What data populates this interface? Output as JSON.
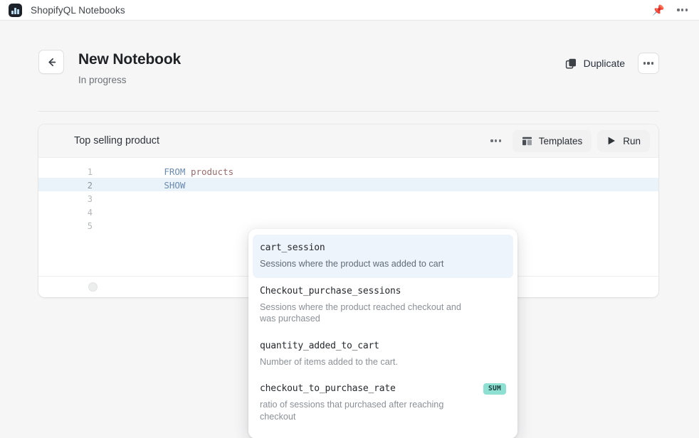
{
  "topbar": {
    "app_icon": "bar-chart-icon",
    "title": "ShopifyQL Notebooks",
    "pin_icon": "pin-icon",
    "menu_icon": "kebab-menu-icon"
  },
  "header": {
    "back_icon": "arrow-left-icon",
    "title": "New Notebook",
    "status": "In progress",
    "duplicate_label": "Duplicate",
    "duplicate_icon": "duplicate-icon",
    "more_icon": "kebab-menu-icon"
  },
  "cell": {
    "title": "Top selling product",
    "kebab_icon": "kebab-menu-icon",
    "templates_label": "Templates",
    "templates_icon": "templates-layout-icon",
    "run_label": "Run",
    "run_icon": "play-icon",
    "footer_icon": "add-cell-icon",
    "code": [
      {
        "number": "1",
        "active": false,
        "keyword": "FROM",
        "identifier": " products"
      },
      {
        "number": "2",
        "active": true,
        "keyword": "SHOW",
        "identifier": ""
      },
      {
        "number": "3",
        "active": false,
        "keyword": "",
        "identifier": ""
      },
      {
        "number": "4",
        "active": false,
        "keyword": "",
        "identifier": ""
      },
      {
        "number": "5",
        "active": false,
        "keyword": "",
        "identifier": ""
      }
    ]
  },
  "autocomplete": {
    "items": [
      {
        "name": "cart_session",
        "description": "Sessions where the product was added to cart",
        "badge": "",
        "selected": true
      },
      {
        "name": "Checkout_purchase_sessions",
        "description": "Sessions where the product reached checkout and was purchased",
        "badge": "",
        "selected": false
      },
      {
        "name": "quantity_added_to_cart",
        "description": "Number of items added to the cart.",
        "badge": "",
        "selected": false
      },
      {
        "name": "checkout_to_purchase_rate",
        "description": "ratio of sessions that purchased after reaching checkout",
        "badge": "SUM",
        "selected": false
      }
    ]
  },
  "colors": {
    "page_bg": "#f6f6f7",
    "card_bg": "#ffffff",
    "accent_badge": "#8ee0d2",
    "selected_row": "#edf4fb",
    "active_line": "#eaf2fa",
    "keyword": "#6a8bb0",
    "identifier": "#9b6b6b",
    "pin": "#d9821a"
  }
}
